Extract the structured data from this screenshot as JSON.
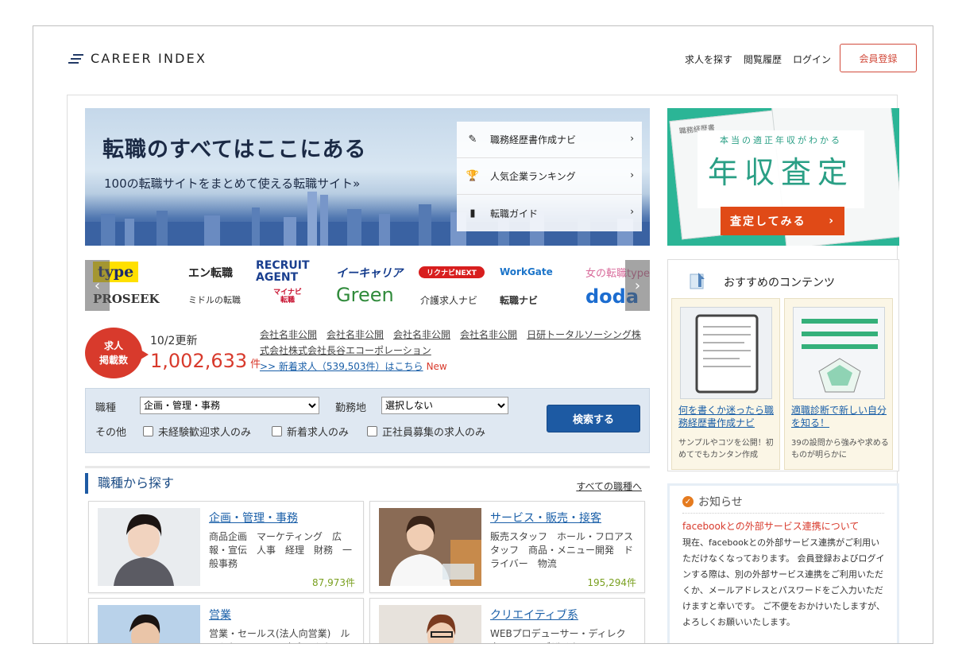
{
  "header": {
    "logo_text": "CAREER INDEX",
    "nav": [
      "求人を探す",
      "閲覧履歴",
      "ログイン"
    ],
    "register_label": "会員登録"
  },
  "hero": {
    "title": "転職のすべてはここにある",
    "subtitle": "100の転職サイトをまとめて使える転職サイト»",
    "menu": [
      {
        "label": "職務経歴書作成ナビ",
        "icon": "pencil-icon"
      },
      {
        "label": "人気企業ランキング",
        "icon": "trophy-icon"
      },
      {
        "label": "転職ガイド",
        "icon": "book-icon"
      }
    ]
  },
  "salary_banner": {
    "small_text": "本当の適正年収がわかる",
    "big_text": "年収査定",
    "button_label": "査定してみる",
    "paper_label": "職務経歴書"
  },
  "logos": {
    "row1": [
      "type",
      "エン転職",
      "RECRUIT AGENT",
      "イーキャリア",
      "リクナビNEXT",
      "WorkGate",
      "女の転職type"
    ],
    "row2": [
      "PROSEEK",
      "ミドルの転職",
      "マイナビ転職",
      "Green",
      "介護求人ナビ",
      "転職ナビ",
      "doda"
    ]
  },
  "count": {
    "badge": [
      "求人",
      "掲載数"
    ],
    "date": "10/2更新",
    "number": "1,002,633",
    "unit": "件",
    "companies": [
      "会社名非公開",
      "会社名非公開",
      "会社名非公開",
      "会社名非公開",
      "日研トータルソーシング株式会社",
      "株式会社長谷エコーポレーション"
    ],
    "new_link": ">> 新着求人（539,503件）はこちら",
    "new_badge": "New"
  },
  "search": {
    "job_label": "職種",
    "job_value": "企画・管理・事務",
    "area_label": "勤務地",
    "area_value": "選択しない",
    "other_label": "その他",
    "checks": [
      "未経験歓迎求人のみ",
      "新着求人のみ",
      "正社員募集の求人のみ"
    ],
    "button_label": "検索する"
  },
  "categories": {
    "title": "職種から探す",
    "all_link": "すべての職種へ",
    "items": [
      {
        "title": "企画・管理・事務",
        "desc": "商品企画　マーケティング　広報・宣伝　人事　経理　財務　一般事務",
        "count": "87,973件"
      },
      {
        "title": "サービス・販売・接客",
        "desc": "販売スタッフ　ホール・フロアスタッフ　商品・メニュー開発　ドライバー　物流",
        "count": "195,294件"
      },
      {
        "title": "営業",
        "desc": "営業・セールス(法人向営業)　ルートセールス・アカウントセールス",
        "count": ""
      },
      {
        "title": "クリエイティブ系",
        "desc": "WEBプロデューサー・ディレクター　WEBデザイナー",
        "count": ""
      }
    ]
  },
  "recommended": {
    "title": "おすすめのコンテンツ",
    "items": [
      {
        "link": "何を書くか迷ったら職務経歴書作成ナビ",
        "desc": "サンプルやコツを公開！初めてでもカンタン作成"
      },
      {
        "link": "適職診断で新しい自分を知る！",
        "desc": "39の設問から強みや求めるものが明らかに"
      }
    ]
  },
  "notice": {
    "title": "お知らせ",
    "headline": "facebookとの外部サービス連携について",
    "body": "現在、facebookとの外部サービス連携がご利用いただけなくなっております。 会員登録およびログインする際は、別の外部サービス連携をご利用いただくか、メールアドレスとパスワードをご入力いただけますと幸いです。 ご不便をおかけいたしますが、よろしくお願いいたします。"
  },
  "colors": {
    "brand_navy": "#223a66",
    "accent_red": "#d83a2c",
    "link_blue": "#1a5fa8",
    "salary_green": "#2bb596",
    "salary_orange": "#e04a17"
  }
}
